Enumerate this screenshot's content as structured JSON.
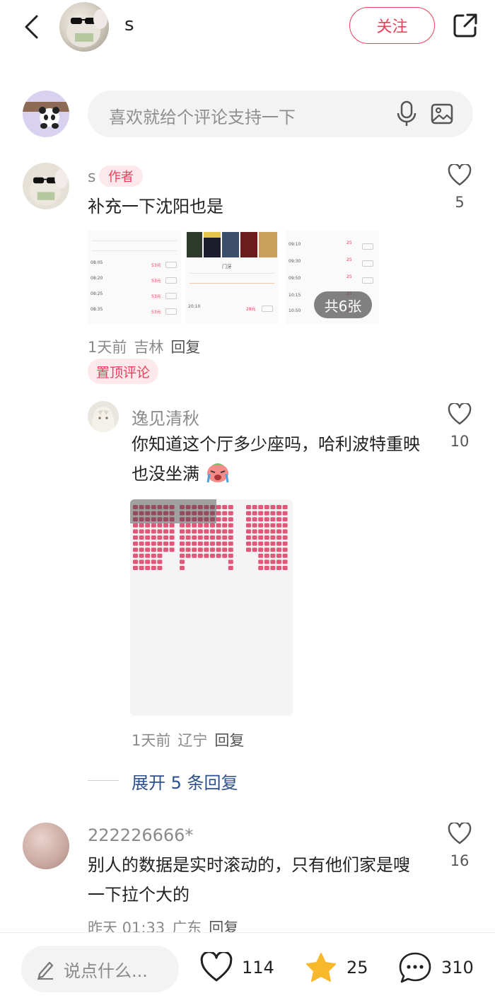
{
  "header": {
    "username": "s",
    "follow_label": "关注"
  },
  "comment_input": {
    "placeholder": "喜欢就给个评论支持一下"
  },
  "comments": [
    {
      "username": "s",
      "badge": "作者",
      "text": "补充一下沈阳也是",
      "image_count_label": "共6张",
      "time": "1天前",
      "location": "吉林",
      "reply_label": "回复",
      "pin_label": "置顶评论",
      "likes": "5",
      "gallery": {
        "img1_rows": [
          {
            "time": "08:05",
            "price": "53元"
          },
          {
            "time": "08:20",
            "price": "53元"
          },
          {
            "time": "08:25",
            "price": "53元"
          },
          {
            "time": "08:35",
            "price": "53元"
          }
        ],
        "img2_title": "门牙",
        "img2_rows": [
          {
            "time": "20:10",
            "price": "28元"
          }
        ],
        "img3_rows": [
          {
            "time": "09:10",
            "price": "25"
          },
          {
            "time": "09:30",
            "price": "25"
          },
          {
            "time": "09:50",
            "price": "25"
          },
          {
            "time": "10:15",
            "price": "25"
          },
          {
            "time": "10:50",
            "price": "25"
          }
        ]
      }
    },
    {
      "username": "逸见清秋",
      "text": "你知道这个厅多少座吗，哈利波特重映也没坐满",
      "time": "1天前",
      "location": "辽宁",
      "reply_label": "回复",
      "likes": "10"
    },
    {
      "username": "222226666*",
      "text": "别人的数据是实时滚动的，只有他们家是嗖一下拉个大的",
      "time": "昨天 01:33",
      "location": "广东",
      "reply_label": "回复",
      "likes": "16"
    }
  ],
  "expand_replies_label": "展开 5 条回复",
  "bottom_bar": {
    "say_placeholder": "说点什么...",
    "likes": "114",
    "favorites": "25",
    "comments": "310"
  },
  "colors": {
    "accent": "#ee3d5a",
    "link": "#2d4f8c",
    "star": "#f7b82e",
    "seat": "#e0577a"
  }
}
